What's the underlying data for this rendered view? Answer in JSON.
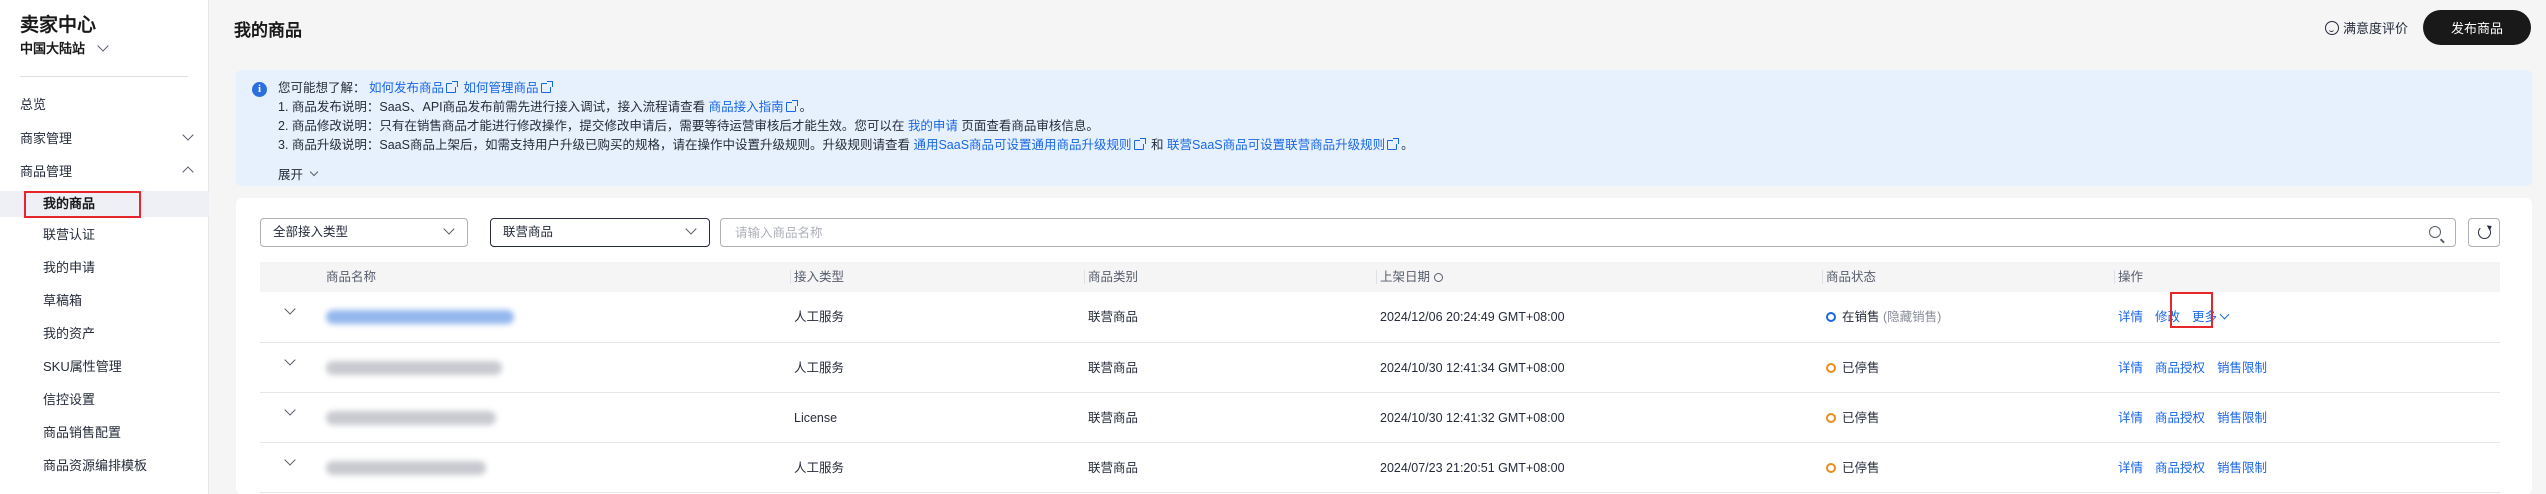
{
  "sidebar": {
    "title": "卖家中心",
    "region": "中国大陆站",
    "items": [
      {
        "label": "总览"
      },
      {
        "label": "商家管理"
      },
      {
        "label": "商品管理"
      }
    ],
    "sub_items": [
      {
        "label": "我的商品"
      },
      {
        "label": "联营认证"
      },
      {
        "label": "我的申请"
      },
      {
        "label": "草稿箱"
      },
      {
        "label": "我的资产"
      },
      {
        "label": "SKU属性管理"
      },
      {
        "label": "信控设置"
      },
      {
        "label": "商品销售配置"
      },
      {
        "label": "商品资源编排模板"
      }
    ]
  },
  "header": {
    "title": "我的商品",
    "rating": "满意度评价",
    "publish": "发布商品"
  },
  "banner": {
    "line0_prefix": "您可能想了解：",
    "link_publish": "如何发布商品",
    "link_manage": "如何管理商品",
    "line1_text": "1. 商品发布说明：SaaS、API商品发布前需先进行接入调试，接入流程请查看",
    "line1_link": "商品接入指南",
    "line1_end": "。",
    "line2_text": "2. 商品修改说明：只有在销售商品才能进行修改操作，提交修改申请后，需要等待运营审核后才能生效。您可以在",
    "line2_link": "我的申请",
    "line2_end": "页面查看商品审核信息。",
    "line3_text": "3. 商品升级说明：SaaS商品上架后，如需支持用户升级已购买的规格，请在操作中设置升级规则。升级规则请查看",
    "line3_link1": "通用SaaS商品可设置通用商品升级规则",
    "line3_mid": "和",
    "line3_link2": "联营SaaS商品可设置联营商品升级规则",
    "line3_end": "。",
    "expand": "展开"
  },
  "filters": {
    "access_type": "全部接入类型",
    "category": "联营商品",
    "search_placeholder": "请输入商品名称"
  },
  "table": {
    "headers": [
      "商品名称",
      "接入类型",
      "商品类别",
      "上架日期",
      "商品状态",
      "操作"
    ],
    "rows": [
      {
        "access": "人工服务",
        "category": "联营商品",
        "date": "2024/12/06 20:24:49 GMT+08:00",
        "status": "在销售",
        "status_note": "(隐藏销售)",
        "status_color": "#1a67e6",
        "ops": [
          "详情",
          "修改",
          "更多"
        ]
      },
      {
        "access": "人工服务",
        "category": "联营商品",
        "date": "2024/10/30 12:41:34 GMT+08:00",
        "status": "已停售",
        "status_note": "",
        "status_color": "#f08c1c",
        "ops": [
          "详情",
          "商品授权",
          "销售限制"
        ]
      },
      {
        "access": "License",
        "category": "联营商品",
        "date": "2024/10/30 12:41:32 GMT+08:00",
        "status": "已停售",
        "status_note": "",
        "status_color": "#f08c1c",
        "ops": [
          "详情",
          "商品授权",
          "销售限制"
        ]
      },
      {
        "access": "人工服务",
        "category": "联营商品",
        "date": "2024/07/23 21:20:51 GMT+08:00",
        "status": "已停售",
        "status_note": "",
        "status_color": "#f08c1c",
        "ops": [
          "详情",
          "商品授权",
          "销售限制"
        ]
      }
    ]
  }
}
